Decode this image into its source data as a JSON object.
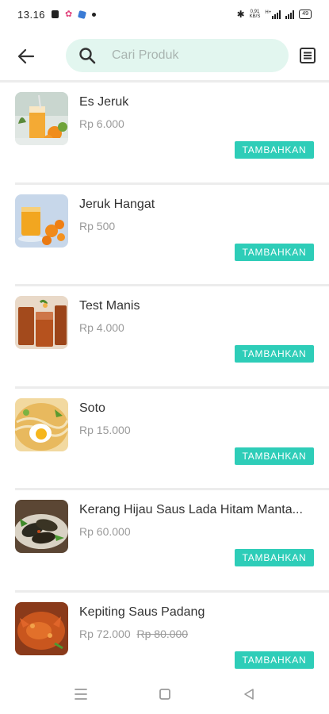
{
  "status_bar": {
    "time": "13.16",
    "speed_top": "0.91",
    "speed_bottom": "KB/S",
    "network_label": "H+",
    "battery": "49"
  },
  "header": {
    "search_placeholder": "Cari Produk"
  },
  "products": [
    {
      "name": "Es Jeruk",
      "price": "Rp 6.000",
      "old_price": "",
      "button_label": "TAMBAHKAN",
      "image": "orange-juice-drink"
    },
    {
      "name": "Jeruk Hangat",
      "price": "Rp 500",
      "old_price": "",
      "button_label": "TAMBAHKAN",
      "image": "warm-orange-drink"
    },
    {
      "name": "Test Manis",
      "price": "Rp 4.000",
      "old_price": "",
      "button_label": "TAMBAHKAN",
      "image": "sweet-iced-tea"
    },
    {
      "name": "Soto",
      "price": "Rp 15.000",
      "old_price": "",
      "button_label": "TAMBAHKAN",
      "image": "soto-soup"
    },
    {
      "name": "Kerang Hijau Saus Lada Hitam Manta...",
      "price": "Rp 60.000",
      "old_price": "",
      "button_label": "TAMBAHKAN",
      "image": "green-mussels"
    },
    {
      "name": "Kepiting Saus Padang",
      "price": "Rp 72.000",
      "old_price": "Rp 80.000",
      "button_label": "TAMBAHKAN",
      "image": "padang-crab"
    }
  ],
  "colors": {
    "accent": "#2ecdb8",
    "search_bg": "#e2f6ef",
    "price_text": "#9a9a9a",
    "divider": "#ececec"
  },
  "icons": {
    "back": "back-arrow-icon",
    "search": "search-icon",
    "menu": "menu-list-icon",
    "nav_recent": "recent-apps-icon",
    "nav_home": "home-icon",
    "nav_back": "nav-back-icon"
  }
}
